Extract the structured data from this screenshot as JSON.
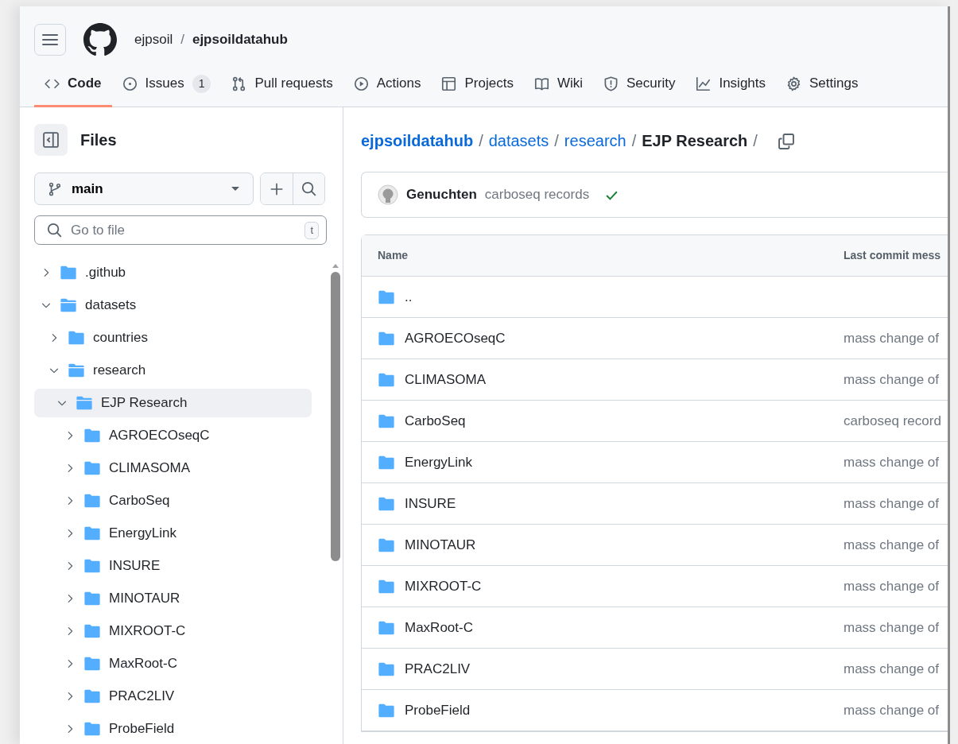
{
  "header": {
    "owner": "ejpsoil",
    "separator": "/",
    "repo": "ejpsoildatahub"
  },
  "tabs": [
    {
      "label": "Code",
      "selected": true
    },
    {
      "label": "Issues",
      "counter": "1",
      "selected": false
    },
    {
      "label": "Pull requests",
      "selected": false
    },
    {
      "label": "Actions",
      "selected": false
    },
    {
      "label": "Projects",
      "selected": false
    },
    {
      "label": "Wiki",
      "selected": false
    },
    {
      "label": "Security",
      "selected": false
    },
    {
      "label": "Insights",
      "selected": false
    },
    {
      "label": "Settings",
      "selected": false
    }
  ],
  "sidebar": {
    "title": "Files",
    "branch": "main",
    "search": {
      "placeholder": "Go to file",
      "shortcut": "t"
    },
    "tree": [
      {
        "name": ".github",
        "expanded": false,
        "selected": false
      },
      {
        "name": "datasets",
        "expanded": true,
        "selected": false,
        "children": [
          {
            "name": "countries",
            "expanded": false,
            "selected": false
          },
          {
            "name": "research",
            "expanded": true,
            "selected": false,
            "children": [
              {
                "name": "EJP Research",
                "expanded": true,
                "selected": true,
                "children": [
                  {
                    "name": "AGROECOseqC",
                    "expanded": false,
                    "selected": false
                  },
                  {
                    "name": "CLIMASOMA",
                    "expanded": false,
                    "selected": false
                  },
                  {
                    "name": "CarboSeq",
                    "expanded": false,
                    "selected": false
                  },
                  {
                    "name": "EnergyLink",
                    "expanded": false,
                    "selected": false
                  },
                  {
                    "name": "INSURE",
                    "expanded": false,
                    "selected": false
                  },
                  {
                    "name": "MINOTAUR",
                    "expanded": false,
                    "selected": false
                  },
                  {
                    "name": "MIXROOT-C",
                    "expanded": false,
                    "selected": false
                  },
                  {
                    "name": "MaxRoot-C",
                    "expanded": false,
                    "selected": false
                  },
                  {
                    "name": "PRAC2LIV",
                    "expanded": false,
                    "selected": false
                  },
                  {
                    "name": "ProbeField",
                    "expanded": false,
                    "selected": false
                  }
                ]
              }
            ]
          }
        ]
      }
    ]
  },
  "breadcrumb": {
    "parts": [
      {
        "label": "ejpsoildatahub",
        "kind": "repo"
      },
      {
        "label": "datasets",
        "kind": "link"
      },
      {
        "label": "research",
        "kind": "link"
      },
      {
        "label": "EJP Research",
        "kind": "current"
      }
    ],
    "separators": [
      "/",
      "/",
      "/",
      "/"
    ]
  },
  "commit": {
    "author": "Genuchten",
    "message": "carboseq records",
    "checks_passed": true
  },
  "table": {
    "columns": [
      "Name",
      "Last commit mess"
    ],
    "rows": [
      {
        "name": ".."
      },
      {
        "name": "AGROECOseqC",
        "message": "mass change of"
      },
      {
        "name": "CLIMASOMA",
        "message": "mass change of"
      },
      {
        "name": "CarboSeq",
        "message": "carboseq record"
      },
      {
        "name": "EnergyLink",
        "message": "mass change of"
      },
      {
        "name": "INSURE",
        "message": "mass change of"
      },
      {
        "name": "MINOTAUR",
        "message": "mass change of"
      },
      {
        "name": "MIXROOT-C",
        "message": "mass change of"
      },
      {
        "name": "MaxRoot-C",
        "message": "mass change of"
      },
      {
        "name": "PRAC2LIV",
        "message": "mass change of"
      },
      {
        "name": "ProbeField",
        "message": "mass change of"
      }
    ]
  }
}
